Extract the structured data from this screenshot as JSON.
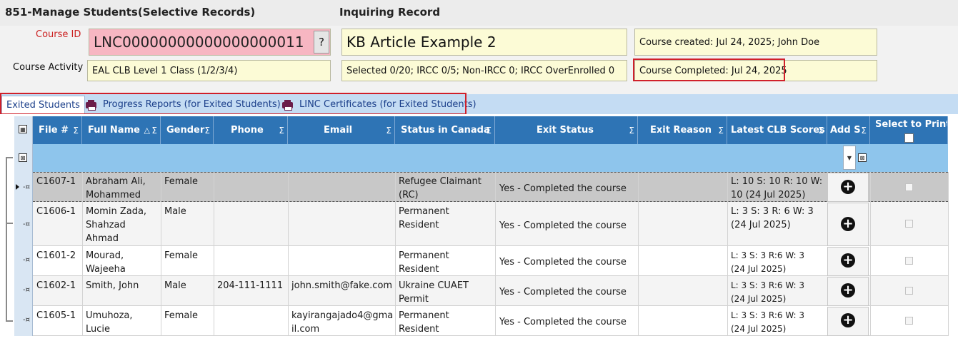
{
  "window": {
    "title": "851-Manage Students(Selective Records)",
    "subtitle": "Inquiring Record"
  },
  "form": {
    "course_id_label": "Course ID",
    "course_id_value": "LNC00000000000000000011",
    "help_button": "?",
    "course_name": "KB Article Example  2",
    "course_created": "Course created: Jul 24, 2025; John Doe",
    "course_activity_label": "Course Activity",
    "course_activity_value": "EAL CLB Level 1 Class (1/2/3/4)",
    "selection_summary": "Selected 0/20; IRCC 0/5; Non-IRCC 0; IRCC OverEnrolled 0",
    "course_completed": "Course Completed: Jul 24, 2025"
  },
  "tabs": [
    {
      "label": "Exited Students",
      "icon": "none"
    },
    {
      "label": "Progress Reports (for Exited Students)",
      "icon": "printer-icon"
    },
    {
      "label": "LINC Certificates (for Exited Students)",
      "icon": "printer-icon"
    }
  ],
  "table": {
    "columns": [
      {
        "label": "File #",
        "sum": "Σ"
      },
      {
        "label": "Full Name",
        "sort": "△",
        "sum": "Σ"
      },
      {
        "label": "Gender",
        "sum": "Σ"
      },
      {
        "label": "Phone",
        "sum": "Σ"
      },
      {
        "label": "Email",
        "sum": "Σ"
      },
      {
        "label": "Status in Canada",
        "sum": "Σ"
      },
      {
        "label": "Exit Status",
        "sum": "Σ"
      },
      {
        "label": "Exit Reason",
        "sum": "Σ"
      },
      {
        "label": "Latest CLB Scores",
        "sum": "Σ"
      },
      {
        "label": "Add S",
        "sum": "Σ"
      },
      {
        "label": "Select to Print",
        "sum": ""
      }
    ],
    "rows": [
      {
        "file": "C1607-1",
        "name1": "Abraham Ali,",
        "name2": "Mohammed",
        "name3": "",
        "gender": "Female",
        "phone": "",
        "email1": "",
        "email2": "",
        "status1": "Refugee Claimant",
        "status2": "(RC)",
        "exit": "Yes - Completed the course",
        "reason": "",
        "clb1": "L: 10 S: 10 R: 10 W:",
        "clb2": "10 (24 Jul 2025)"
      },
      {
        "file": "C1606-1",
        "name1": "Momin Zada,",
        "name2": "Shahzad",
        "name3": "Ahmad",
        "gender": "Male",
        "phone": "",
        "email1": "",
        "email2": "",
        "status1": "Permanent Resident",
        "status2": "",
        "exit": "Yes - Completed the course",
        "reason": "",
        "clb1": "L: 3 S: 3 R: 6 W: 3",
        "clb2": "(24 Jul 2025)"
      },
      {
        "file": "C1601-2",
        "name1": "Mourad,",
        "name2": "Wajeeha",
        "name3": "",
        "gender": "Female",
        "phone": "",
        "email1": "",
        "email2": "",
        "status1": "Permanent Resident",
        "status2": "",
        "exit": "Yes - Completed the course",
        "reason": "",
        "clb1": "L: 3 S: 3 R:6 W: 3",
        "clb2": "(24 Jul 2025)"
      },
      {
        "file": "C1602-1",
        "name1": "Smith, John",
        "name2": "",
        "name3": "",
        "gender": "Male",
        "phone": "204-111-1111",
        "email1": "john.smith@fake.com",
        "email2": "",
        "status1": "Ukraine CUAET",
        "status2": "Permit",
        "exit": "Yes - Completed the course",
        "reason": "",
        "clb1": "L: 3 S: 3 R:6 W: 3",
        "clb2": "(24 Jul 2025)"
      },
      {
        "file": "C1605-1",
        "name1": "Umuhoza,",
        "name2": "Lucie",
        "name3": "",
        "gender": "Female",
        "phone": "",
        "email1": "kayirangajado4@gma",
        "email2": "il.com",
        "status1": "Permanent Resident",
        "status2": "",
        "exit": "Yes - Completed the course",
        "reason": "",
        "clb1": "L: 3 S: 3 R:6 W: 3",
        "clb2": "(24 Jul 2025)"
      }
    ]
  },
  "colors": {
    "header": "#2e74b5",
    "filter_row": "#8ec5ec",
    "course_id_bg": "#f7b6c2",
    "field_bg": "#fcfbd6",
    "highlight": "#d0202a",
    "tab_bar": "#c4dcf3",
    "selected_row": "#c8c8c8"
  }
}
